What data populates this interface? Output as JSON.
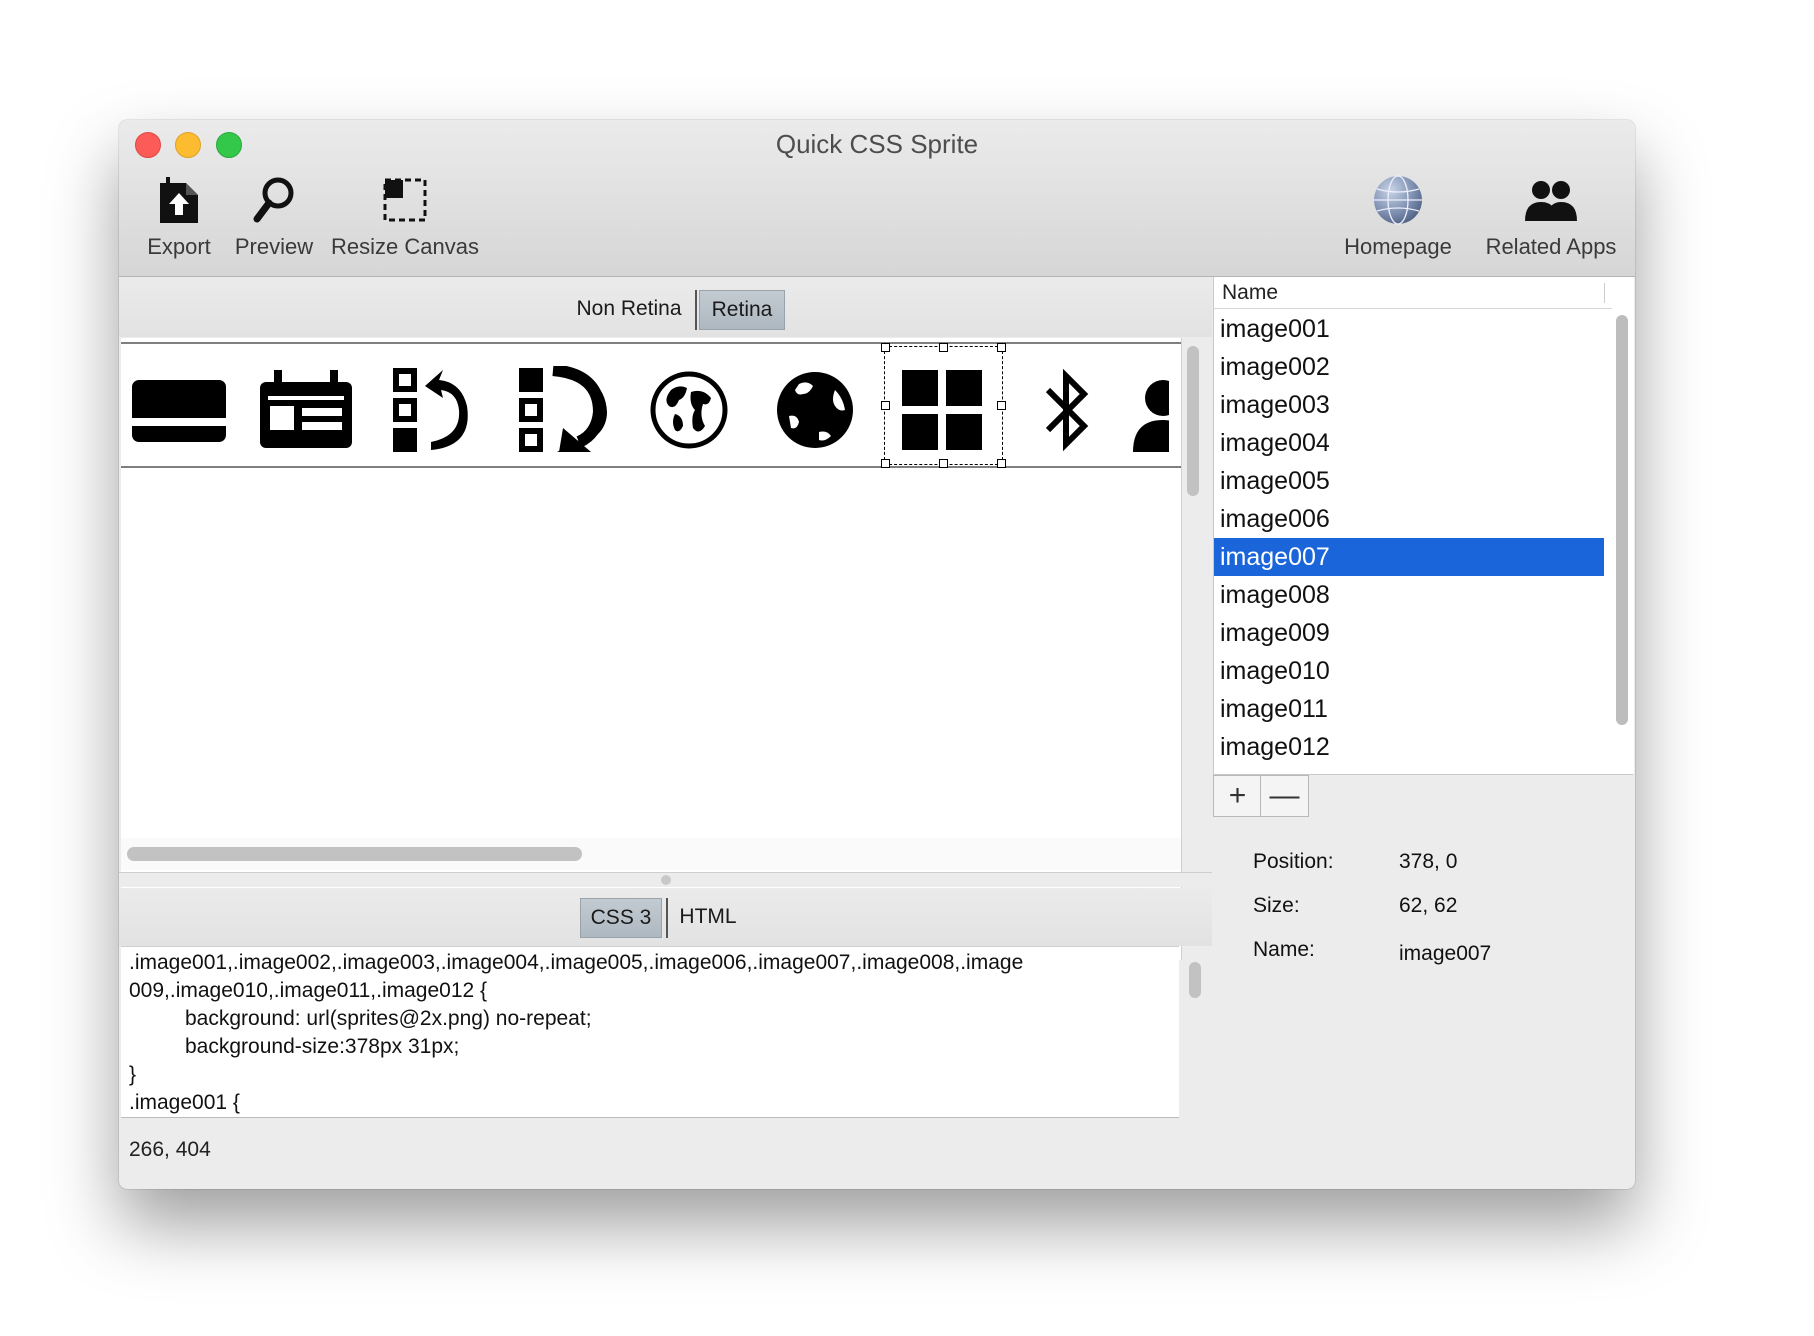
{
  "window": {
    "title": "Quick CSS Sprite"
  },
  "toolbar": {
    "export_label": "Export",
    "preview_label": "Preview",
    "resize_label": "Resize Canvas",
    "homepage_label": "Homepage",
    "related_label": "Related Apps"
  },
  "resolution_tabs": {
    "non_retina": "Non Retina",
    "retina": "Retina",
    "selected": "Retina"
  },
  "sprites": [
    {
      "icon": "credit-card-icon"
    },
    {
      "icon": "calendar-icon"
    },
    {
      "icon": "list-undo-icon"
    },
    {
      "icon": "list-redo-icon"
    },
    {
      "icon": "globe-outline-icon"
    },
    {
      "icon": "globe-solid-icon"
    },
    {
      "icon": "grid-icon",
      "selected": true
    },
    {
      "icon": "bluetooth-icon"
    },
    {
      "icon": "person-icon"
    }
  ],
  "output_tabs": {
    "css": "CSS 3",
    "html": "HTML",
    "selected": "CSS 3"
  },
  "code": {
    "line1": ".image001,.image002,.image003,.image004,.image005,.image006,.image007,.image008,.image",
    "line2": "009,.image010,.image011,.image012 {",
    "line3": "background: url(sprites@2x.png) no-repeat;",
    "line4": "background-size:378px 31px;",
    "line5": "}",
    "line6": ".image001 {"
  },
  "status": {
    "coords": "266, 404"
  },
  "list": {
    "header": "Name",
    "items": [
      "image001",
      "image002",
      "image003",
      "image004",
      "image005",
      "image006",
      "image007",
      "image008",
      "image009",
      "image010",
      "image011",
      "image012"
    ],
    "selected": "image007"
  },
  "list_buttons": {
    "add": "+",
    "remove": "—"
  },
  "properties": {
    "position_label": "Position:",
    "position_value": "378, 0",
    "size_label": "Size:",
    "size_value": "62, 62",
    "name_label": "Name:",
    "name_value": "image007"
  },
  "colors": {
    "selection": "#1a65d9",
    "segment_selected": "#b4bec6"
  }
}
